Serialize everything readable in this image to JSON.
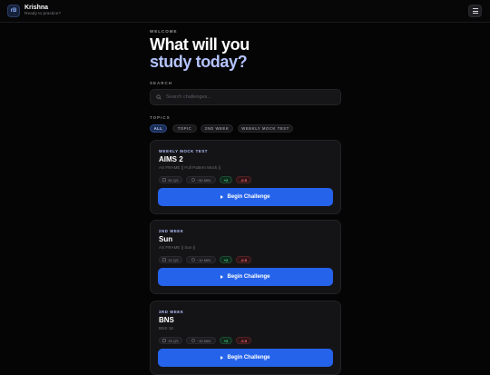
{
  "header": {
    "logo_text": "rB",
    "user_name": "Krishna",
    "user_status": "Ready to practice?",
    "menu_icon": "hamburger-icon"
  },
  "hero": {
    "eyebrow": "WELCOME",
    "line1": "What will you",
    "line2": "study today?"
  },
  "search": {
    "label": "SEARCH",
    "placeholder": "Search challenges...",
    "value": ""
  },
  "topics": {
    "label": "TOPICS",
    "chips": [
      {
        "label": "ALL",
        "active": true
      },
      {
        "label": "TOPIC",
        "active": false
      },
      {
        "label": "2ND WEEK",
        "active": false
      },
      {
        "label": "WEEKLY MOCK TEST",
        "active": false
      }
    ]
  },
  "cards": [
    {
      "tag": "WEEKLY MOCK TEST",
      "title": "AIMS 2",
      "subtitle": "AS FRAME || Full Pattern Mock ||",
      "questions": "50 QS",
      "time": "~50 MIN",
      "plus": "+2",
      "minus": "-0.5",
      "button": "Begin Challenge"
    },
    {
      "tag": "2ND WEEK",
      "title": "Sun",
      "subtitle": "AS FRAME || Sun ||",
      "questions": "10 QS",
      "time": "~10 MIN",
      "plus": "+2",
      "minus": "-0.5",
      "button": "Begin Challenge"
    },
    {
      "tag": "3RD WEEK",
      "title": "BNS",
      "subtitle": "BNS 18",
      "questions": "25 QS",
      "time": "~15 MIN",
      "plus": "+2",
      "minus": "-0.5",
      "button": "Begin Challenge"
    }
  ],
  "colors": {
    "background": "#050505",
    "accent": "#2563eb",
    "highlight_text": "#b4c3ff",
    "positive": "#4ed88b",
    "negative": "#ff6b73"
  }
}
